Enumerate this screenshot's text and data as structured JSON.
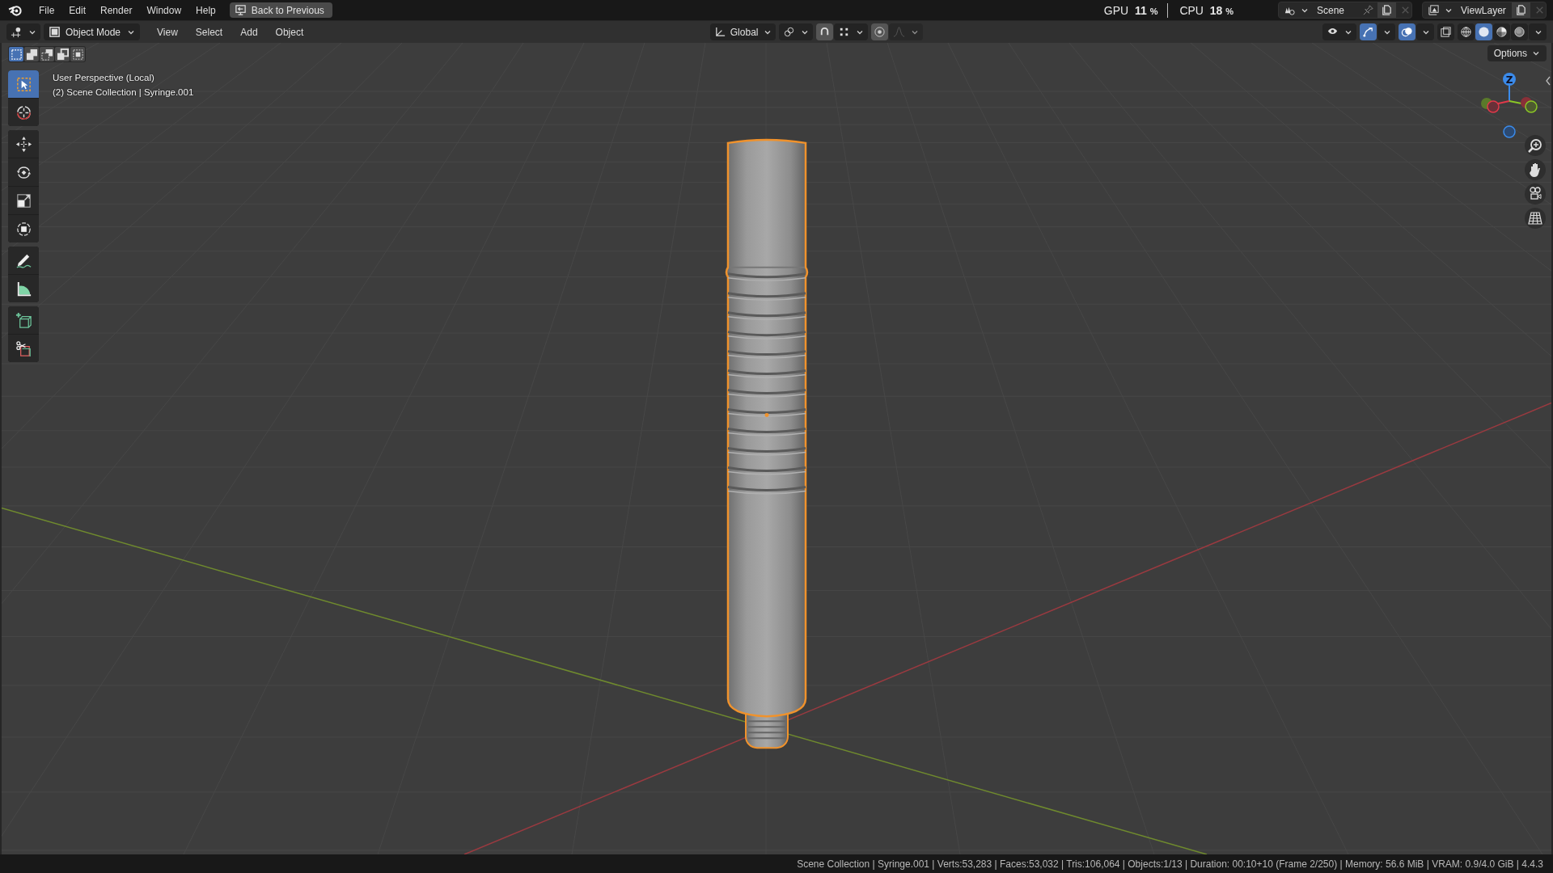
{
  "menu_bar": {
    "menus": [
      "File",
      "Edit",
      "Render",
      "Window",
      "Help"
    ],
    "back_button": "Back to Previous"
  },
  "stats": [
    {
      "label": "GPU",
      "value": "11",
      "unit": "%"
    },
    {
      "label": "CPU",
      "value": "18",
      "unit": "%"
    }
  ],
  "scene": {
    "name": "Scene"
  },
  "view_layer": {
    "name": "ViewLayer"
  },
  "header": {
    "mode": "Object Mode",
    "menus": [
      "View",
      "Select",
      "Add",
      "Object"
    ],
    "orientation": "Global",
    "snap_on": true,
    "proportional_on": true,
    "gizmos_on": true,
    "overlays_on": true,
    "xray_on": false,
    "shading": [
      {
        "kind": "wireframe",
        "selected": false
      },
      {
        "kind": "solid",
        "selected": true
      },
      {
        "kind": "material",
        "selected": false
      },
      {
        "kind": "rendered",
        "selected": false
      }
    ]
  },
  "select_modes": [
    {
      "kind": "new",
      "selected": true
    },
    {
      "kind": "extend",
      "selected": false
    },
    {
      "kind": "subtract",
      "selected": false
    },
    {
      "kind": "invert",
      "selected": false
    },
    {
      "kind": "intersect",
      "selected": false
    }
  ],
  "tool_groups": [
    [
      {
        "kind": "select",
        "selected": true
      },
      {
        "kind": "cursor",
        "selected": false
      }
    ],
    [
      {
        "kind": "move",
        "selected": false
      },
      {
        "kind": "rotate",
        "selected": false
      },
      {
        "kind": "scale",
        "selected": false
      },
      {
        "kind": "transform",
        "selected": false
      }
    ],
    [
      {
        "kind": "annotate",
        "selected": false
      },
      {
        "kind": "measure",
        "selected": false
      }
    ],
    [
      {
        "kind": "add-cube",
        "selected": false
      },
      {
        "kind": "cut",
        "selected": false
      }
    ]
  ],
  "viewport": {
    "view_name": "User Perspective (Local)",
    "collection_info": "(2) Scene Collection | Syringe.001",
    "options_button": "Options",
    "gizmo_axis": "Z"
  },
  "status_bar": "Scene Collection | Syringe.001 | Verts:53,283 | Faces:53,032 | Tris:106,064 | Objects:1/13 | Duration: 00:10+10 (Frame 2/250) | Memory: 56.6 MiB | VRAM: 0.9/4.0 GiB | 4.4.3"
}
